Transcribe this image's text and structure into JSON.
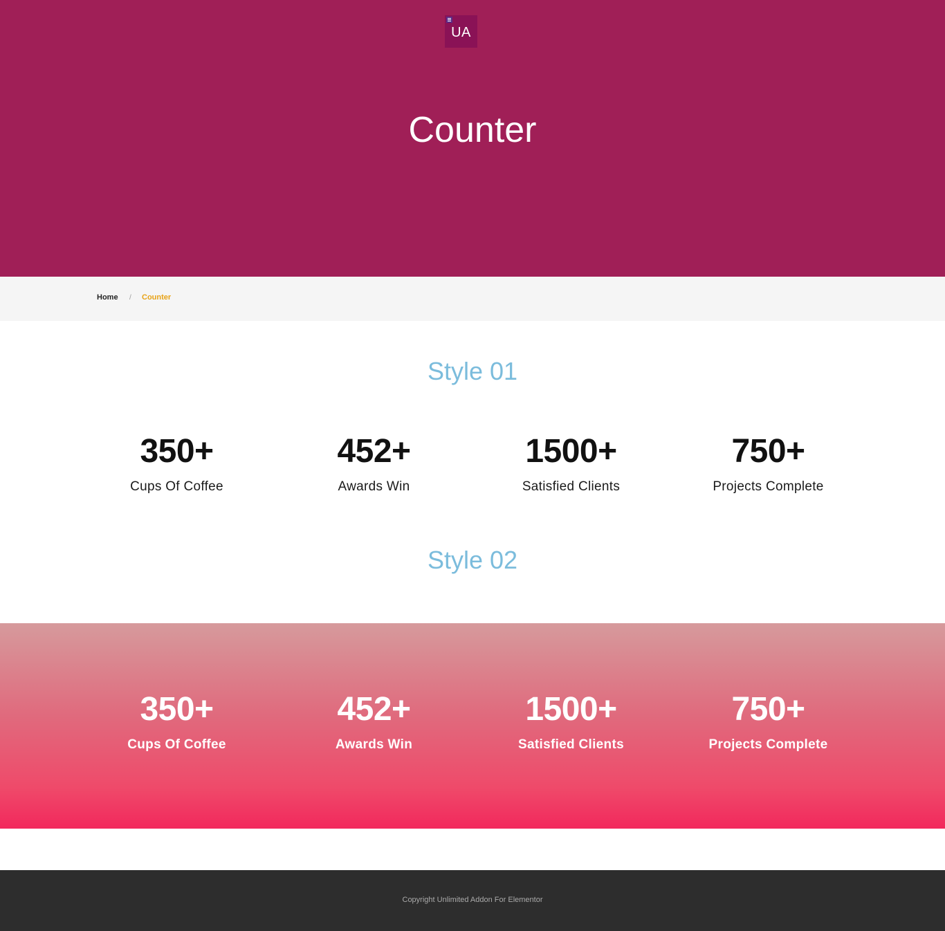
{
  "hero": {
    "logo_text": "UA",
    "title": "Counter",
    "background": "#a01f57"
  },
  "breadcrumb": {
    "home": "Home",
    "separator": "/",
    "current": "Counter",
    "current_color": "#e8a317"
  },
  "style1": {
    "heading": "Style 01",
    "counters": [
      {
        "value": "350+",
        "label": "Cups Of Coffee"
      },
      {
        "value": "452+",
        "label": "Awards Win"
      },
      {
        "value": "1500+",
        "label": "Satisfied Clients"
      },
      {
        "value": "750+",
        "label": "Projects Complete"
      }
    ]
  },
  "style2": {
    "heading": "Style 02",
    "counters": [
      {
        "value": "350+",
        "label": "Cups Of Coffee"
      },
      {
        "value": "452+",
        "label": "Awards Win"
      },
      {
        "value": "1500+",
        "label": "Satisfied Clients"
      },
      {
        "value": "750+",
        "label": "Projects Complete"
      }
    ],
    "gradient_colors": [
      "#d69a9c",
      "#f2285c"
    ]
  },
  "footer": {
    "copyright": "Copyright Unlimited Addon For Elementor"
  }
}
